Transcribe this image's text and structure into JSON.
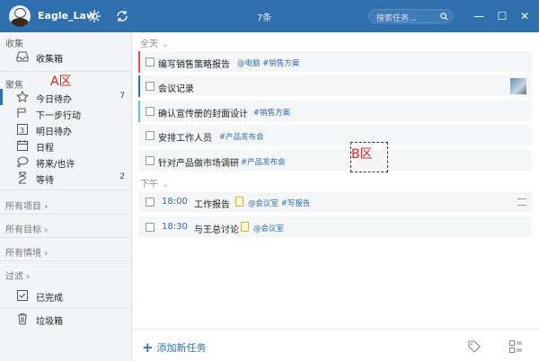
{
  "titlebar": {
    "username": "Eagle_Law",
    "count": "7条",
    "search_placeholder": "搜索任务...",
    "minimize": "—",
    "maximize": "☐",
    "close": "✕"
  },
  "sidebar": {
    "collect_head": "收集",
    "inbox": "收集箱",
    "focus_head": "聚焦",
    "zone_a": "A区",
    "items": [
      {
        "label": "今日待办",
        "count": "7"
      },
      {
        "label": "下一步行动",
        "count": ""
      },
      {
        "label": "明日待办",
        "count": ""
      },
      {
        "label": "日程",
        "count": ""
      },
      {
        "label": "将来/也许",
        "count": ""
      },
      {
        "label": "等待",
        "count": "2"
      }
    ],
    "all_projects": "所有项目",
    "all_goals": "所有目标",
    "all_contexts": "所有情境",
    "filter": "过滤",
    "completed": "已完成",
    "trash": "垃圾箱"
  },
  "main": {
    "allday_head": "全天",
    "afternoon_head": "下午",
    "zone_b": "B区",
    "allday_tasks": [
      {
        "title": "编写销售策略报告",
        "tags": "@电脑  #销售方案",
        "bar": "#d9534f"
      },
      {
        "title": "会议记录",
        "tags": "",
        "bar": "#2f6fad"
      },
      {
        "title": "确认宣传册的封面设计",
        "tags": "#销售方案",
        "bar": "#5bc0de"
      },
      {
        "title": "安排工作人员",
        "tags": "#产品发布会",
        "bar": ""
      },
      {
        "title": "针对产品做市场调研",
        "tags": "#产品发布会",
        "bar": ""
      }
    ],
    "afternoon_tasks": [
      {
        "time": "18:00",
        "title": "工作报告",
        "tags": "@会议室  #写报告"
      },
      {
        "time": "18:30",
        "title": "与王总讨论",
        "tags": "@会议室"
      }
    ],
    "add_task": "添加新任务"
  },
  "colors": {
    "accent": "#2f6fad",
    "zone_label": "#e0241b"
  }
}
